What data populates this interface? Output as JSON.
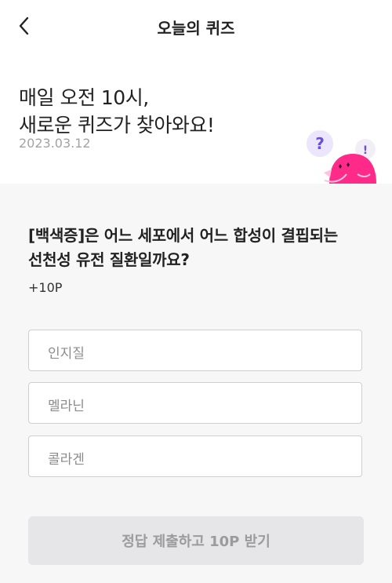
{
  "header": {
    "title": "오늘의 퀴즈",
    "back_icon": "chevron-left-icon"
  },
  "hero": {
    "line1": "매일 오전 10시,",
    "line2": "새로운 퀴즈가 찾아와요!",
    "date": "2023.03.12",
    "mascot_icon": "quiz-mascot-icon"
  },
  "quiz": {
    "question_line1": "[백색증]은 어느 세포에서 어느 합성이 결핍되는",
    "question_line2": "선천성 유전 질환일까요?",
    "points": "+10P",
    "options": [
      "인지질",
      "멜라닌",
      "콜라겐"
    ]
  },
  "submit": {
    "label": "정답 제출하고 10P 받기"
  },
  "colors": {
    "accent_pink": "#ff2a8a",
    "accent_purple": "#6b4fd6",
    "submit_bg": "#e6e6e8"
  }
}
